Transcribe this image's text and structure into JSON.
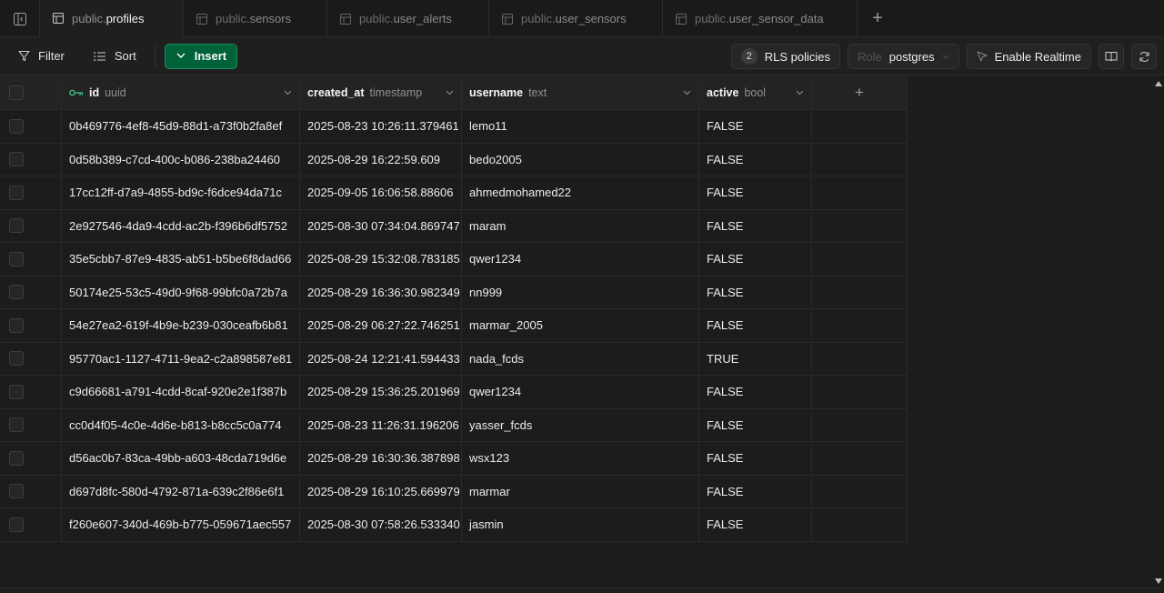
{
  "tabs": [
    {
      "schema": "public.",
      "name": "profiles",
      "active": true
    },
    {
      "schema": "public.",
      "name": "sensors",
      "active": false
    },
    {
      "schema": "public.",
      "name": "user_alerts",
      "active": false
    },
    {
      "schema": "public.",
      "name": "user_sensors",
      "active": false
    },
    {
      "schema": "public.",
      "name": "user_sensor_data",
      "active": false
    }
  ],
  "toolbar": {
    "filter_label": "Filter",
    "sort_label": "Sort",
    "insert_label": "Insert",
    "rls_count": "2",
    "rls_label": "RLS policies",
    "role_prefix": "Role",
    "role_value": "postgres",
    "realtime_label": "Enable Realtime"
  },
  "columns": [
    {
      "name": "id",
      "type": "uuid"
    },
    {
      "name": "created_at",
      "type": "timestamp"
    },
    {
      "name": "username",
      "type": "text"
    },
    {
      "name": "active",
      "type": "bool"
    }
  ],
  "rows": [
    {
      "id": "0b469776-4ef8-45d9-88d1-a73f0b2fa8ef",
      "created_at": "2025-08-23 10:26:11.379461",
      "username": "lemo11",
      "active": "FALSE"
    },
    {
      "id": "0d58b389-c7cd-400c-b086-238ba24460",
      "created_at": "2025-08-29 16:22:59.609",
      "username": "bedo2005",
      "active": "FALSE"
    },
    {
      "id": "17cc12ff-d7a9-4855-bd9c-f6dce94da71c",
      "created_at": "2025-09-05 16:06:58.88606",
      "username": "ahmedmohamed22",
      "active": "FALSE"
    },
    {
      "id": "2e927546-4da9-4cdd-ac2b-f396b6df5752",
      "created_at": "2025-08-30 07:34:04.869747",
      "username": "maram",
      "active": "FALSE"
    },
    {
      "id": "35e5cbb7-87e9-4835-ab51-b5be6f8dad66",
      "created_at": "2025-08-29 15:32:08.783185",
      "username": "qwer1234",
      "active": "FALSE"
    },
    {
      "id": "50174e25-53c5-49d0-9f68-99bfc0a72b7a",
      "created_at": "2025-08-29 16:36:30.982349",
      "username": "nn999",
      "active": "FALSE"
    },
    {
      "id": "54e27ea2-619f-4b9e-b239-030ceafb6b81",
      "created_at": "2025-08-29 06:27:22.746251",
      "username": "marmar_2005",
      "active": "FALSE"
    },
    {
      "id": "95770ac1-1127-4711-9ea2-c2a898587e81",
      "created_at": "2025-08-24 12:21:41.594433",
      "username": "nada_fcds",
      "active": "TRUE"
    },
    {
      "id": "c9d66681-a791-4cdd-8caf-920e2e1f387b",
      "created_at": "2025-08-29 15:36:25.201969",
      "username": "qwer1234",
      "active": "FALSE"
    },
    {
      "id": "cc0d4f05-4c0e-4d6e-b813-b8cc5c0a774",
      "created_at": "2025-08-23 11:26:31.196206",
      "username": "yasser_fcds",
      "active": "FALSE"
    },
    {
      "id": "d56ac0b7-83ca-49bb-a603-48cda719d6e",
      "created_at": "2025-08-29 16:30:36.387898",
      "username": "wsx123",
      "active": "FALSE"
    },
    {
      "id": "d697d8fc-580d-4792-871a-639c2f86e6f1",
      "created_at": "2025-08-29 16:10:25.669979",
      "username": "marmar",
      "active": "FALSE"
    },
    {
      "id": "f260e607-340d-469b-b775-059671aec557",
      "created_at": "2025-08-30 07:58:26.533340",
      "username": "jasmin",
      "active": "FALSE"
    }
  ],
  "colors": {
    "accent": "#3ecf8e",
    "insert_bg": "#006239",
    "background": "#1c1c1c"
  },
  "icons": {
    "sidebar_toggle": "sidebar-toggle-icon",
    "table": "table-icon",
    "key": "primary-key-icon",
    "refresh": "refresh-icon",
    "docs": "book-icon"
  }
}
